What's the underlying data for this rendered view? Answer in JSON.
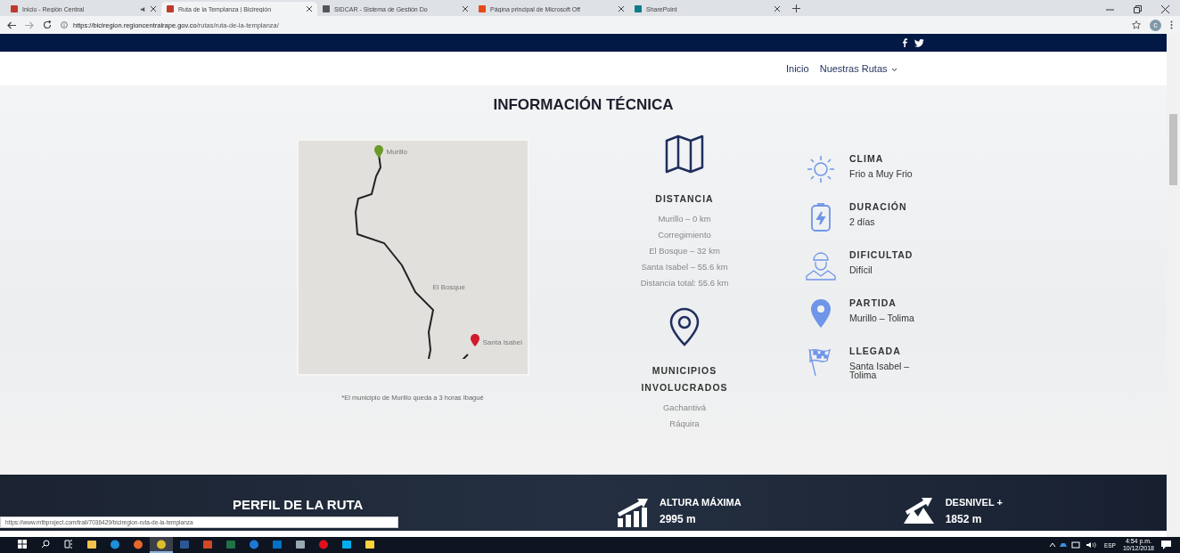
{
  "browser": {
    "tabs": [
      {
        "title": "Inicio - Región Central",
        "selected": false,
        "muted": true,
        "kind": "site"
      },
      {
        "title": "Ruta de la Templanza | Biciregión",
        "selected": true,
        "muted": false,
        "kind": "site"
      },
      {
        "title": "SIDCAR - Sistema de Gestión Do",
        "selected": false,
        "muted": false,
        "kind": "doc"
      },
      {
        "title": "Página principal de Microsoft Off",
        "selected": false,
        "muted": false,
        "kind": "office"
      },
      {
        "title": "SharePoint",
        "selected": false,
        "muted": false,
        "kind": "sharepoint"
      }
    ],
    "url_host": "https://biciregion.regioncentralrape.gov.co",
    "url_path": "/rutas/ruta-de-la-templanza/",
    "avatar": "c"
  },
  "nav": {
    "items": [
      {
        "label": "Inicio",
        "dropdown": false
      },
      {
        "label": "Nuestras Rutas",
        "dropdown": true
      }
    ]
  },
  "section": {
    "title": "INFORMACIÓN TÉCNICA",
    "map": {
      "labels": [
        {
          "text": "Murillo",
          "kind": "start"
        },
        {
          "text": "El Bosque",
          "kind": "mid"
        },
        {
          "text": "Santa Isabel",
          "kind": "end"
        }
      ],
      "caption": "*El municipio de Murillo queda a 3 horas Ibagué"
    },
    "center": [
      {
        "kind": "map",
        "title": "DISTANCIA",
        "lines": [
          "Murillo – 0 km",
          "Corregimiento",
          "El Bosque – 32 km",
          "Santa Isabel – 55.6 km",
          "Distancia total: 55.6 km"
        ]
      },
      {
        "kind": "pin",
        "title": "MUNICIPIOS INVOLUCRADOS",
        "lines": [
          "Gachantivá",
          "Ráquira"
        ]
      }
    ],
    "facts": [
      {
        "kind": "sun",
        "title": "CLIMA",
        "value": "Frio a Muy Frio"
      },
      {
        "kind": "battery",
        "title": "DURACIÓN",
        "value": "2 días"
      },
      {
        "kind": "cyclist",
        "title": "DIFICULTAD",
        "value": "Difícil"
      },
      {
        "kind": "marker",
        "title": "PARTIDA",
        "value": "Murillo – Tolima"
      },
      {
        "kind": "flag",
        "title": "LLEGADA",
        "value": "Santa Isabel – Tolima"
      }
    ]
  },
  "profile": {
    "title": "PERFIL DE LA RUTA",
    "stats": [
      {
        "kind": "bars",
        "title": "ALTURA MÁXIMA",
        "value": "2995 m"
      },
      {
        "kind": "mountain",
        "title": "DESNIVEL +",
        "value": "1852 m"
      }
    ]
  },
  "status_url": "https://www.mtbproject.com/trail/7036429/biciregion-ruta-de-la-templanza",
  "taskbar": {
    "apps": [
      {
        "kind": "explorer",
        "selected": false
      },
      {
        "kind": "ie",
        "selected": false
      },
      {
        "kind": "firefox",
        "selected": false
      },
      {
        "kind": "chrome",
        "selected": true
      },
      {
        "kind": "word",
        "selected": false
      },
      {
        "kind": "powerpoint",
        "selected": false
      },
      {
        "kind": "excel",
        "selected": false
      },
      {
        "kind": "edge",
        "selected": false
      },
      {
        "kind": "outlook",
        "selected": false
      },
      {
        "kind": "tool",
        "selected": false
      },
      {
        "kind": "opera",
        "selected": false
      },
      {
        "kind": "skype",
        "selected": false
      },
      {
        "kind": "sun",
        "selected": false
      }
    ],
    "language": "ESP",
    "time": "4:54 p.m.",
    "date": "10/12/2018"
  }
}
